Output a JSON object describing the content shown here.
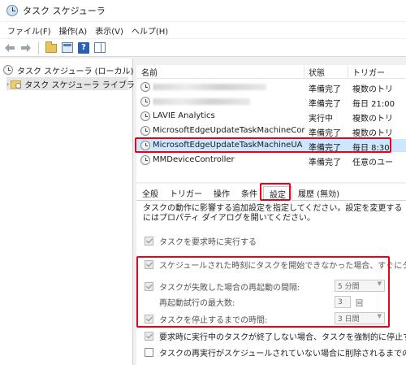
{
  "app": {
    "title": "タスク スケジューラ"
  },
  "menu": {
    "items": [
      "ファイル(F)",
      "操作(A)",
      "表示(V)",
      "ヘルプ(H)"
    ]
  },
  "toolbar": {
    "icons": [
      "back-arrow-icon",
      "forward-arrow-icon",
      "folder-up-icon",
      "properties-icon",
      "help-icon",
      "show-hide-panel-icon"
    ],
    "help_label": "?"
  },
  "tree": {
    "root_label": "タスク スケジューラ (ローカル)",
    "library_label": "タスク スケジューラ ライブラリ",
    "expand_glyph": "›"
  },
  "task_list": {
    "headers": {
      "name": "名前",
      "status": "状態",
      "trigger": "トリガー"
    },
    "rows": [
      {
        "name": "",
        "blurred": true,
        "status": "準備完了",
        "trigger": "複数のトリ"
      },
      {
        "name": "",
        "blurred": true,
        "status": "準備完了",
        "trigger": "毎日 21:00"
      },
      {
        "name": "LAVIE Analytics",
        "blurred": false,
        "status": "実行中",
        "trigger": "複数のトリ"
      },
      {
        "name": "MicrosoftEdgeUpdateTaskMachineCore",
        "blurred": false,
        "status": "準備完了",
        "trigger": "複数のトリ"
      },
      {
        "name": "MicrosoftEdgeUpdateTaskMachineUA",
        "blurred": false,
        "status": "準備完了",
        "trigger": "毎日 8:30",
        "selected": true
      },
      {
        "name": "MMDeviceController",
        "blurred": false,
        "status": "準備完了",
        "trigger": "任意のユー"
      }
    ]
  },
  "tabs": {
    "items": [
      "全般",
      "トリガー",
      "操作",
      "条件",
      "設定",
      "履歴 (無効)"
    ],
    "active_index": 4
  },
  "settings": {
    "description": "タスクの動作に影響する追加設定を指定してください。設定を変更するにはプロパティ ダイアログを開いてください。",
    "options": [
      {
        "label": "タスクを要求時に実行する",
        "checked": true
      },
      {
        "label": "スケジュールされた時刻にタスクを開始できなかった場合、すぐにタスクを開始する",
        "checked": true
      },
      {
        "label": "タスクが失敗した場合の再起動の間隔:",
        "checked": true,
        "value": "5 分間"
      },
      {
        "label": "再起動試行の最大数:",
        "checked": null,
        "value": "3",
        "suffix": "回"
      },
      {
        "label": "タスクを停止するまでの時間:",
        "checked": true,
        "value": "3 日間"
      },
      {
        "label": "要求時に実行中のタスクが終了しない場合、タスクを強制的に停止する",
        "checked": true
      },
      {
        "label": "タスクの再実行がスケジュールされていない場合に削除されるまでの時間",
        "checked": false
      }
    ]
  },
  "colors": {
    "highlight": "#e8001c",
    "selection": "#cce8ff"
  }
}
